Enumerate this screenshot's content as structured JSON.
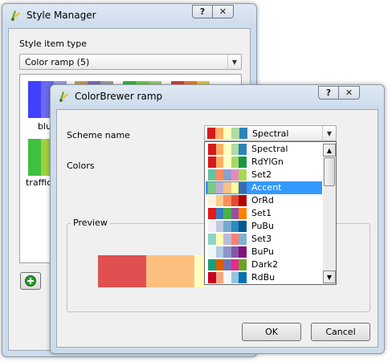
{
  "style_manager": {
    "title": "Style Manager",
    "help_label": "?",
    "close_label": "✕",
    "item_type_label": "Style item type",
    "item_type_value": "Color ramp (5)",
    "items": [
      {
        "label": "blu",
        "colors": [
          "#4040ff",
          "#6a6af0",
          "#a0a0e8"
        ]
      },
      {
        "label": "",
        "colors": [
          "#d0a060",
          "#8070c0",
          "#a0a0a0"
        ]
      },
      {
        "label": "",
        "colors": [
          "#30c030",
          "#70d040",
          "#a0d070"
        ]
      },
      {
        "label": "",
        "colors": [
          "#e04040",
          "#f08030",
          "#e0d040"
        ]
      },
      {
        "label": "traffic",
        "colors": [
          "#40c040",
          "#a0d040",
          "#e0e040"
        ]
      }
    ],
    "add_icon": "plus-icon"
  },
  "colorbrewer": {
    "title": "ColorBrewer ramp",
    "help_label": "?",
    "close_label": "✕",
    "scheme_label": "Scheme name",
    "scheme_value": "Spectral",
    "scheme_value_colors": [
      "#d7191c",
      "#fdae61",
      "#ffffbf",
      "#abdda4",
      "#2b83ba"
    ],
    "colors_label": "Colors",
    "preview_label": "Preview",
    "preview_colors": [
      "#e05050",
      "#fdbf80",
      "#ffffc0"
    ],
    "ok_label": "OK",
    "cancel_label": "Cancel"
  },
  "dropdown": {
    "selected_index": 3,
    "items": [
      {
        "name": "Spectral",
        "colors": [
          "#d7191c",
          "#fdae61",
          "#ffffbf",
          "#abdda4",
          "#2b83ba"
        ]
      },
      {
        "name": "RdYlGn",
        "colors": [
          "#d7191c",
          "#fdae61",
          "#ffffbf",
          "#a6d96a",
          "#1a9641"
        ]
      },
      {
        "name": "Set2",
        "colors": [
          "#66c2a5",
          "#fc8d62",
          "#8da0cb",
          "#e78ac3",
          "#a6d854"
        ]
      },
      {
        "name": "Accent",
        "colors": [
          "#7fc97f",
          "#beaed4",
          "#fdc086",
          "#ffff99",
          "#386cb0"
        ]
      },
      {
        "name": "OrRd",
        "colors": [
          "#fef0d9",
          "#fdcc8a",
          "#fc8d59",
          "#e34a33",
          "#b30000"
        ]
      },
      {
        "name": "Set1",
        "colors": [
          "#e41a1c",
          "#377eb8",
          "#4daf4a",
          "#984ea3",
          "#ff7f00"
        ]
      },
      {
        "name": "PuBu",
        "colors": [
          "#f1eef6",
          "#bdc9e1",
          "#74a9cf",
          "#2b8cbe",
          "#045a8d"
        ]
      },
      {
        "name": "Set3",
        "colors": [
          "#8dd3c7",
          "#ffffb3",
          "#bebada",
          "#fb8072",
          "#80b1d3"
        ]
      },
      {
        "name": "BuPu",
        "colors": [
          "#edf8fb",
          "#b3cde3",
          "#8c96c6",
          "#8856a7",
          "#810f7c"
        ]
      },
      {
        "name": "Dark2",
        "colors": [
          "#1b9e77",
          "#d95f02",
          "#7570b3",
          "#e7298a",
          "#66a61e"
        ]
      },
      {
        "name": "RdBu",
        "colors": [
          "#ca0020",
          "#f4a582",
          "#f7f7f7",
          "#92c5de",
          "#0571b0"
        ]
      }
    ],
    "scroll_up": "▲",
    "scroll_down": "▼"
  }
}
